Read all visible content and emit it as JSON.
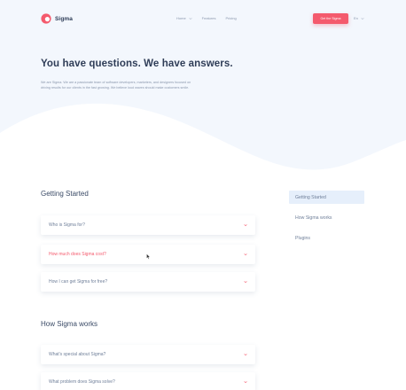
{
  "brand": {
    "name": "Sigma",
    "accent": "#f45a6d"
  },
  "nav": {
    "items": [
      {
        "label": "Home",
        "has_dropdown": true
      },
      {
        "label": "Features",
        "has_dropdown": false
      },
      {
        "label": "Pricing",
        "has_dropdown": false
      }
    ],
    "cta_label": "Get the Sigma",
    "language": "En"
  },
  "hero": {
    "title": "You have questions. We have answers.",
    "text": "We are Sigma. We are a passionate team of software developers, marketers, and designers focused on driving results for our clients in the fast growing. We believe loud waves should make customers smile."
  },
  "sections": [
    {
      "title": "Getting Started",
      "questions": [
        {
          "label": "Who is Sigma for?",
          "active": false
        },
        {
          "label": "How much does Sigma cost?",
          "active": true
        },
        {
          "label": "How I can get Sigma for free?",
          "active": false
        }
      ]
    },
    {
      "title": "How Sigma works",
      "questions": [
        {
          "label": "What's special about Sigma?",
          "active": false
        },
        {
          "label": "What problem does Sigma solve?",
          "active": false
        }
      ]
    }
  ],
  "sidebar": {
    "items": [
      {
        "label": "Getting Started",
        "active": true
      },
      {
        "label": "How Sigma works",
        "active": false
      },
      {
        "label": "Plugins",
        "active": false
      }
    ]
  }
}
